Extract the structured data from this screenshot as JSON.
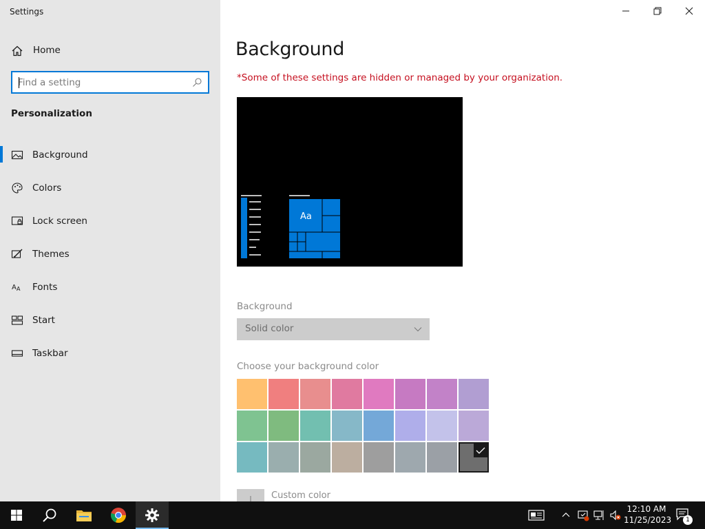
{
  "window": {
    "app_title": "Settings",
    "controls": {
      "minimize": "minimize",
      "restore": "restore",
      "close": "close"
    }
  },
  "sidebar": {
    "home_label": "Home",
    "search": {
      "placeholder": "Find a setting",
      "value": ""
    },
    "section_title": "Personalization",
    "items": [
      {
        "label": "Background",
        "icon": "picture-icon",
        "active": true
      },
      {
        "label": "Colors",
        "icon": "palette-icon",
        "active": false
      },
      {
        "label": "Lock screen",
        "icon": "lock-screen-icon",
        "active": false
      },
      {
        "label": "Themes",
        "icon": "themes-icon",
        "active": false
      },
      {
        "label": "Fonts",
        "icon": "fonts-icon",
        "active": false
      },
      {
        "label": "Start",
        "icon": "start-icon",
        "active": false
      },
      {
        "label": "Taskbar",
        "icon": "taskbar-icon",
        "active": false
      }
    ]
  },
  "main": {
    "title": "Background",
    "warning": "*Some of these settings are hidden or managed by your organization.",
    "preview": {
      "tile_text": "Aa",
      "accent": "#0078d7"
    },
    "background_label": "Background",
    "background_value": "Solid color",
    "color_label": "Choose your background color",
    "swatch_rows": [
      [
        "#ffc06f",
        "#f07f7f",
        "#e88e8e",
        "#e07aa0",
        "#e07ac0",
        "#c67ac2",
        "#c282c8",
        "#b19ed2"
      ],
      [
        "#7fc391",
        "#7fbb7f",
        "#72bfb0",
        "#86b8c8",
        "#74a8d8",
        "#afaeea",
        "#c3c2ea",
        "#bba9d8"
      ],
      [
        "#76bac0",
        "#9aaeae",
        "#9ba8a0",
        "#bcaea0",
        "#9e9e9e",
        "#9ea8ae",
        "#9ba0a6",
        "#6e6e6e"
      ]
    ],
    "selected_swatch": [
      2,
      7
    ],
    "custom_color_label": "Custom color"
  },
  "taskbar": {
    "clock_time": "12:10 AM",
    "clock_date": "11/25/2023",
    "notification_count": "1",
    "settings_accent": "#76b9ed"
  }
}
